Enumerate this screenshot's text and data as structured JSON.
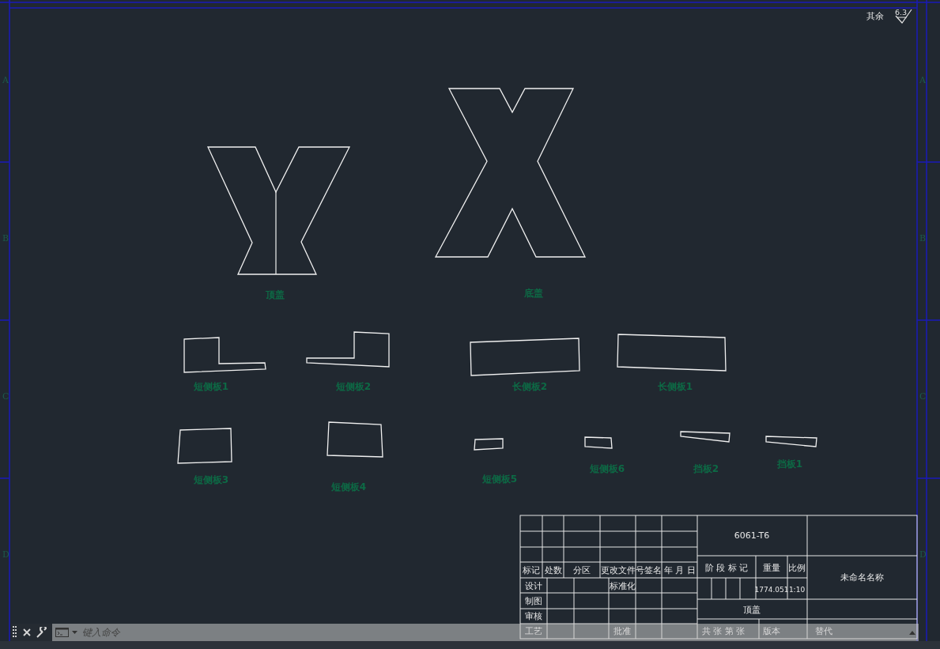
{
  "surface_note": {
    "label": "其余",
    "value": "6.3"
  },
  "zone_labels": {
    "left": [
      "A",
      "B",
      "C",
      "D"
    ],
    "right": [
      "A",
      "B",
      "C",
      "D"
    ]
  },
  "parts": [
    {
      "label": "顶盖"
    },
    {
      "label": "底盖"
    },
    {
      "label": "短侧板1"
    },
    {
      "label": "短侧板2"
    },
    {
      "label": "长侧板2"
    },
    {
      "label": "长侧板1"
    },
    {
      "label": "短侧板3"
    },
    {
      "label": "短侧板4"
    },
    {
      "label": "短侧板5"
    },
    {
      "label": "短侧板6"
    },
    {
      "label": "挡板2"
    },
    {
      "label": "挡板1"
    }
  ],
  "title_block": {
    "change_header": [
      "标记",
      "处数",
      "分区",
      "更改文件号签名",
      "年 月 日"
    ],
    "row_labels": [
      "设计",
      "制图",
      "审核",
      "工艺"
    ],
    "standardization": "标准化",
    "approval": "批准",
    "material": "6061-T6",
    "stage_mark": "阶 段 标 记",
    "weight_label": "重量",
    "scale_label": "比例",
    "weight": "1774.051",
    "scale": "1:10",
    "drawing_name": "未命名名称",
    "part_name": "顶盖",
    "sheet": "共 张 第 张",
    "version": "版本",
    "replaces": "替代"
  },
  "command_line": {
    "placeholder": "键入命令"
  }
}
